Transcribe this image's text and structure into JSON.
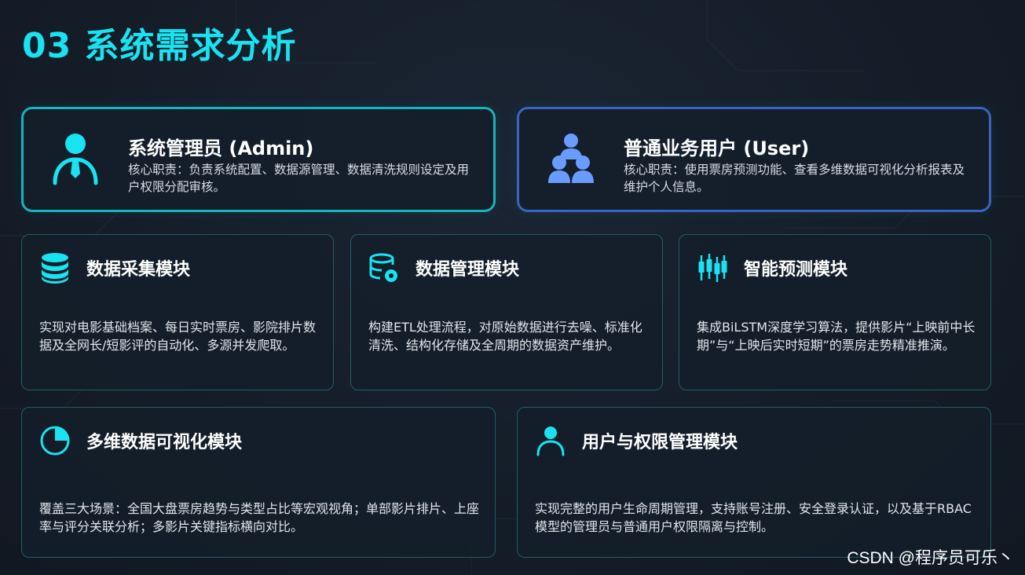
{
  "title": "03 系统需求分析",
  "colors": {
    "accent": "#19e3f0",
    "admin_border": "#16b4bd",
    "user_border": "#3a63c2",
    "user_icon": "#6a9bff"
  },
  "roles": [
    {
      "title": "系统管理员 (Admin)",
      "icon": "admin-person-icon",
      "desc": "核心职责：负责系统配置、数据源管理、数据清洗规则设定及用户权限分配审核。"
    },
    {
      "title": "普通业务用户 (User)",
      "icon": "user-group-icon",
      "desc": "核心职责：使用票房预测功能、查看多维数据可视化分析报表及维护个人信息。"
    }
  ],
  "modules": [
    {
      "title": "数据采集模块",
      "icon": "database-stack-icon",
      "desc": "实现对电影基础档案、每日实时票房、影院排片数据及全网长/短影评的自动化、多源并发爬取。"
    },
    {
      "title": "数据管理模块",
      "icon": "database-gear-icon",
      "desc": "构建ETL处理流程，对原始数据进行去噪、标准化清洗、结构化存储及全周期的数据资产维护。"
    },
    {
      "title": "智能预测模块",
      "icon": "candlestick-icon",
      "desc": "集成BiLSTM深度学习算法，提供影片“上映前中长期”与“上映后实时短期”的票房走势精准推演。"
    },
    {
      "title": "多维数据可视化模块",
      "icon": "pie-chart-icon",
      "desc": "覆盖三大场景：全国大盘票房趋势与类型占比等宏观视角；单部影片排片、上座率与评分关联分析；多影片关键指标横向对比。"
    },
    {
      "title": "用户与权限管理模块",
      "icon": "user-outline-icon",
      "desc": "实现完整的用户生命周期管理，支持账号注册、安全登录认证，以及基于RBAC模型的管理员与普通用户权限隔离与控制。"
    }
  ],
  "watermark": "CSDN @程序员可乐丶"
}
